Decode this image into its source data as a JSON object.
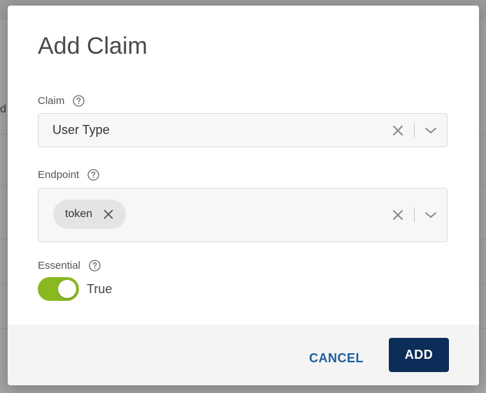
{
  "background": {
    "partial_text": "d"
  },
  "dialog": {
    "title": "Add Claim",
    "claim": {
      "label": "Claim",
      "value": "User Type",
      "help_icon": "question-circle-icon",
      "clear_icon": "close-icon",
      "dropdown_icon": "chevron-down-icon"
    },
    "endpoint": {
      "label": "Endpoint",
      "chips": [
        "token"
      ],
      "help_icon": "question-circle-icon",
      "clear_icon": "close-icon",
      "dropdown_icon": "chevron-down-icon"
    },
    "essential": {
      "label": "Essential",
      "value": true,
      "value_label": "True",
      "help_icon": "question-circle-icon"
    },
    "actions": {
      "cancel_label": "CANCEL",
      "add_label": "ADD"
    }
  },
  "colors": {
    "toggle_on": "#8ab820",
    "primary_button": "#0c2d57",
    "link_button": "#1f5e9c",
    "footer_bg": "#f4f4f4"
  }
}
